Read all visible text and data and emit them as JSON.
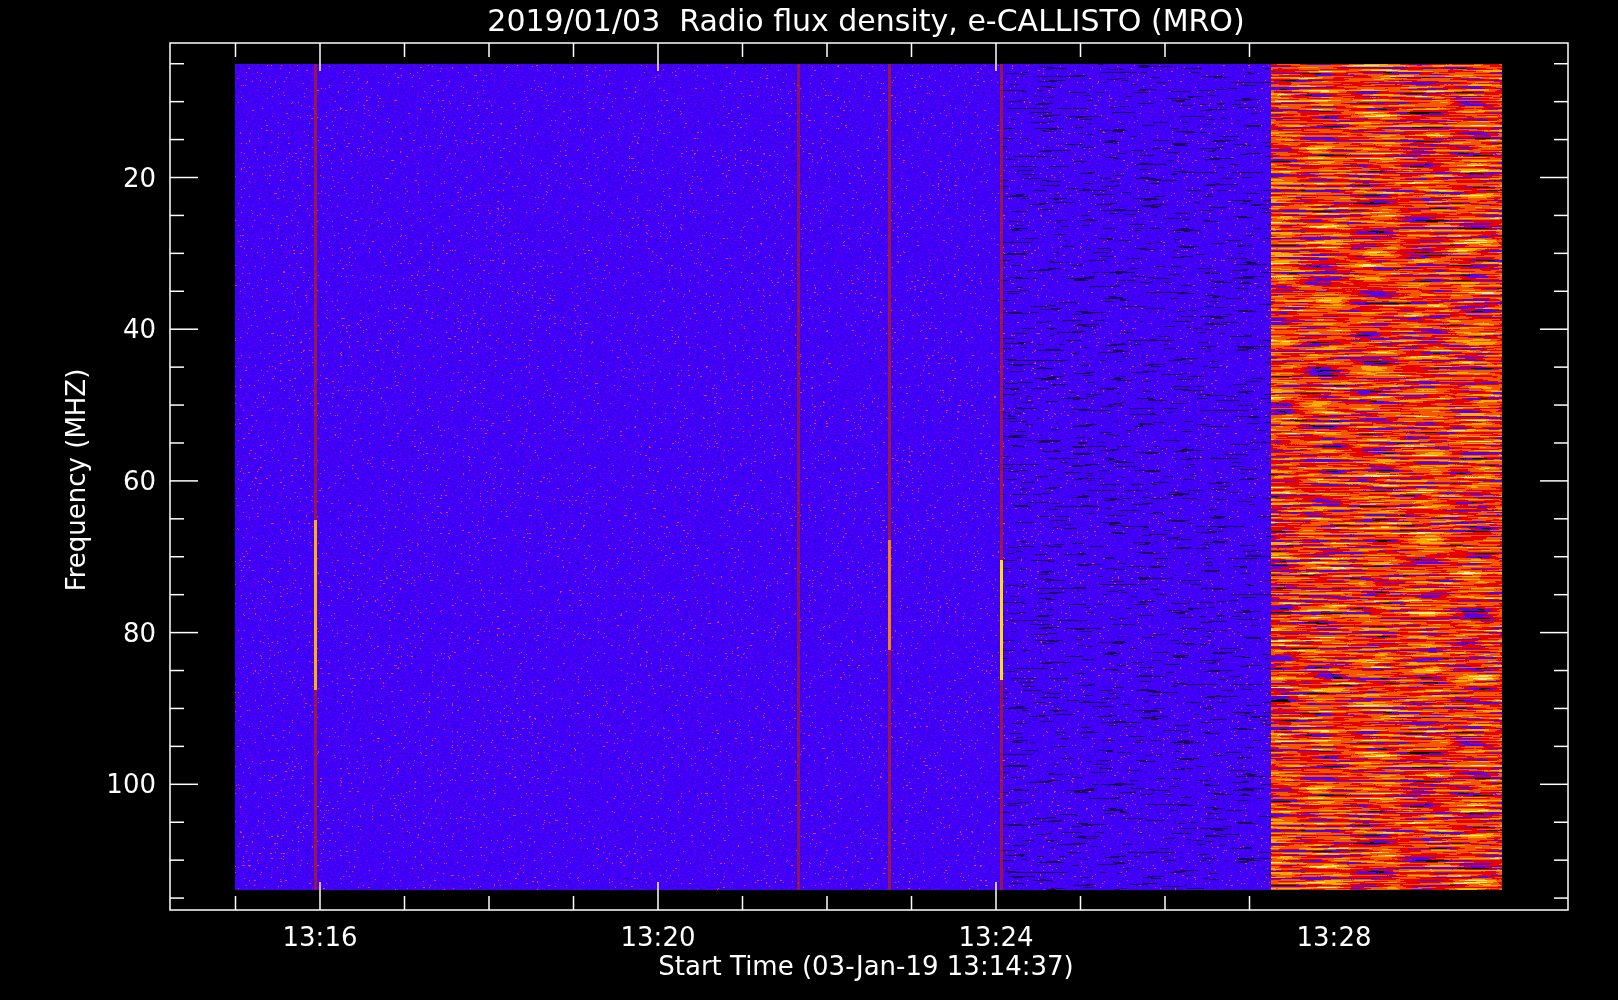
{
  "title": "2019/01/03  Radio flux density, e-CALLISTO (MRO)",
  "y_axis": {
    "label": "Frequency (MHZ)",
    "ticks": [
      "20",
      "40",
      "60",
      "80",
      "100"
    ]
  },
  "x_axis": {
    "label": "Start Time (03-Jan-19 13:14:37)",
    "ticks": [
      "13:16",
      "13:20",
      "13:24",
      "13:28"
    ]
  }
}
